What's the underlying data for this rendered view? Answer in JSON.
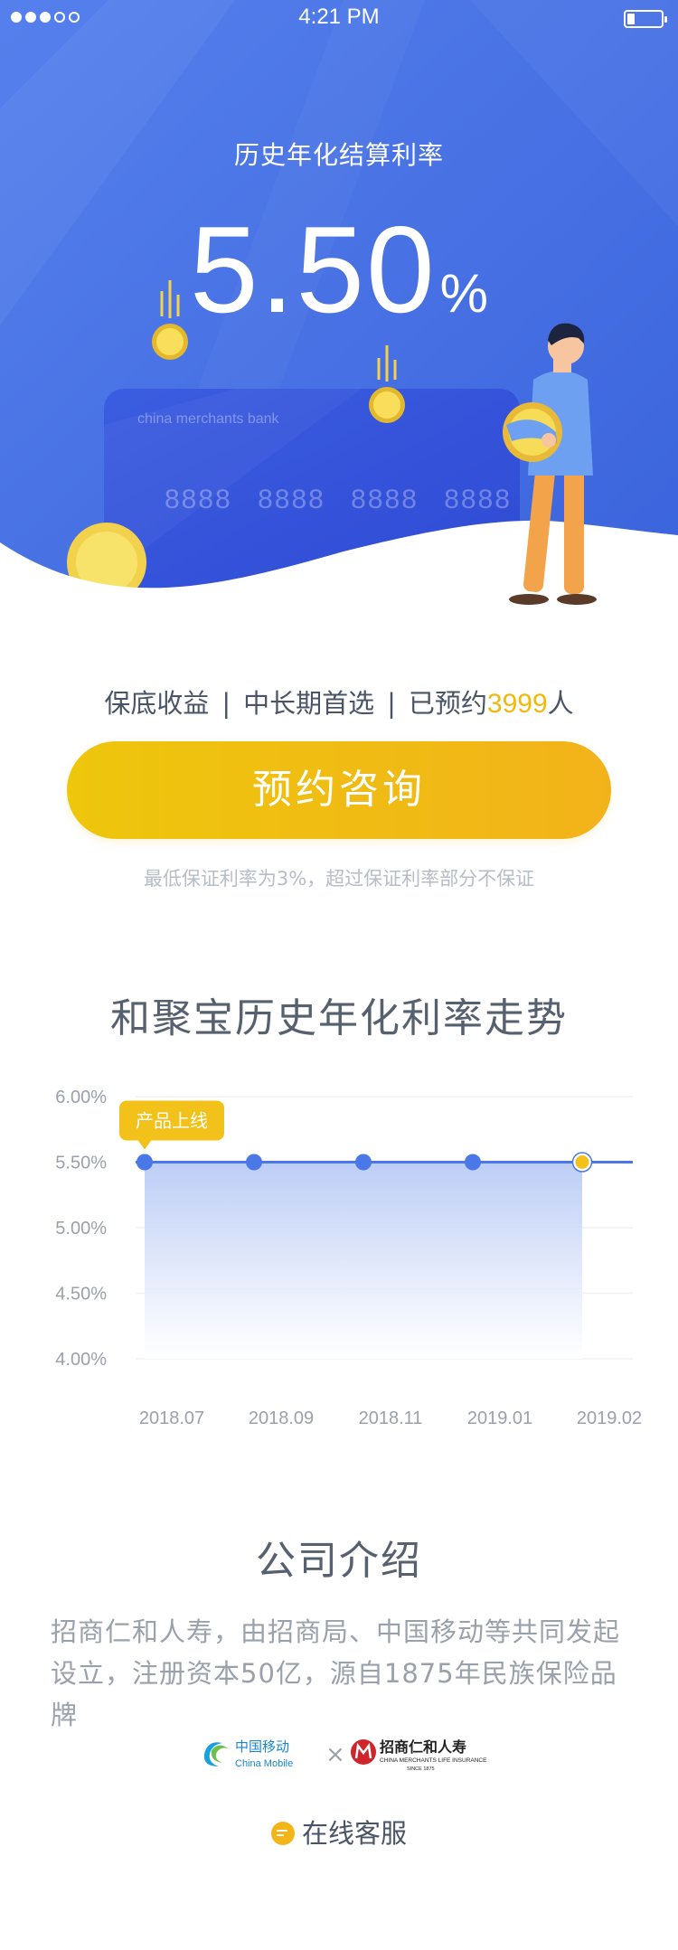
{
  "status_bar": {
    "time": "4:21 PM"
  },
  "hero": {
    "label": "历史年化结算利率",
    "rate": "5.50",
    "unit": "%",
    "card_bank_text": "china merchants bank",
    "card_number": "8888 8888 8888 8888"
  },
  "tagline": {
    "part1": "保底收益",
    "separator": "|",
    "part2": "中长期首选",
    "part3_prefix": "已预约",
    "count": "3999",
    "part3_suffix": "人"
  },
  "cta": {
    "label": "预约咨询"
  },
  "disclaimer": "最低保证利率为3%，超过保证利率部分不保证",
  "chart_section": {
    "title": "和聚宝历史年化利率走势"
  },
  "chart_data": {
    "type": "line",
    "title": "和聚宝历史年化利率走势",
    "categories": [
      "2018.07",
      "2018.09",
      "2018.11",
      "2019.01",
      "2019.02"
    ],
    "values": [
      5.5,
      5.5,
      5.5,
      5.5,
      5.5
    ],
    "y_ticks": [
      "6.00%",
      "5.50%",
      "5.00%",
      "4.50%",
      "4.00%"
    ],
    "ylim": [
      4.0,
      6.0
    ],
    "grid": true,
    "annotation": "产品上线",
    "line_color": "#4a78e6",
    "last_point_color": "#f2c21a"
  },
  "company": {
    "title": "公司介绍",
    "intro_line1": "招商仁和人寿，由招商局、中国移动等共同发起",
    "intro_line2": "设立，注册资本50亿，源自1875年民族保险品牌",
    "partner1_cn": "中国移动",
    "partner1_en": "China Mobile",
    "cross": "×",
    "partner2_cn": "招商仁和人寿",
    "partner2_en": "CHINA MERCHANTS LIFE INSURANCE",
    "partner2_since": "SINCE 1875"
  },
  "customer_service": {
    "label": "在线客服"
  },
  "colors": {
    "brand_blue": "#4a72e4",
    "accent_yellow": "#f0b90b"
  }
}
